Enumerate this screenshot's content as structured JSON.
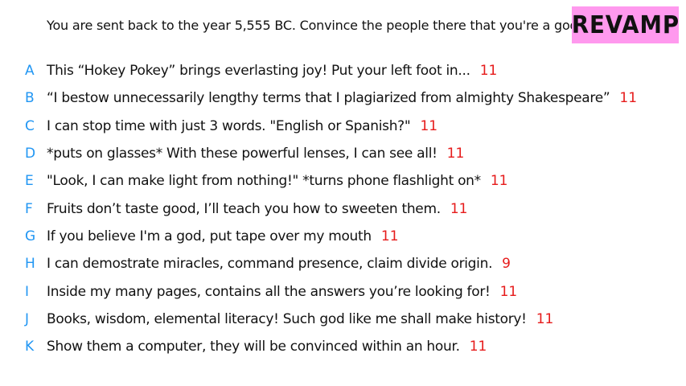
{
  "prompt": "You are sent back to the year 5,555 BC. Convince the people there that you're a god.",
  "badge": "REVAMP",
  "colors": {
    "letter": "#2196f3",
    "score": "#e61b1b",
    "badge_bg": "#ff99ee",
    "text": "#111111"
  },
  "answers": [
    {
      "letter": "A",
      "text": "This “Hokey Pokey” brings everlasting joy! Put your left foot in...",
      "score": "11"
    },
    {
      "letter": "B",
      "text": "“I bestow unnecessarily lengthy terms that I plagiarized from almighty Shakespeare”",
      "score": "11"
    },
    {
      "letter": "C",
      "text": "I can stop time with just 3 words. \"English or Spanish?\"",
      "score": "11"
    },
    {
      "letter": "D",
      "text": "*puts on glasses* With these powerful lenses, I can see all!",
      "score": "11"
    },
    {
      "letter": "E",
      "text": "\"Look, I can make light from nothing!\" *turns phone flashlight on*",
      "score": "11"
    },
    {
      "letter": "F",
      "text": "Fruits don’t taste good, I’ll teach you how to sweeten them.",
      "score": "11"
    },
    {
      "letter": "G",
      "text": "If you believe I'm a god, put tape over my mouth",
      "score": "11"
    },
    {
      "letter": "H",
      "text": "I can demostrate miracles, command presence, claim divide origin.",
      "score": "9"
    },
    {
      "letter": "I",
      "text": "Inside my many pages, contains all the answers you’re looking for!",
      "score": "11"
    },
    {
      "letter": "J",
      "text": "Books, wisdom, elemental literacy! Such god like me shall make history!",
      "score": "11"
    },
    {
      "letter": "K",
      "text": "Show them a computer, they will be convinced within an hour.",
      "score": "11"
    }
  ]
}
